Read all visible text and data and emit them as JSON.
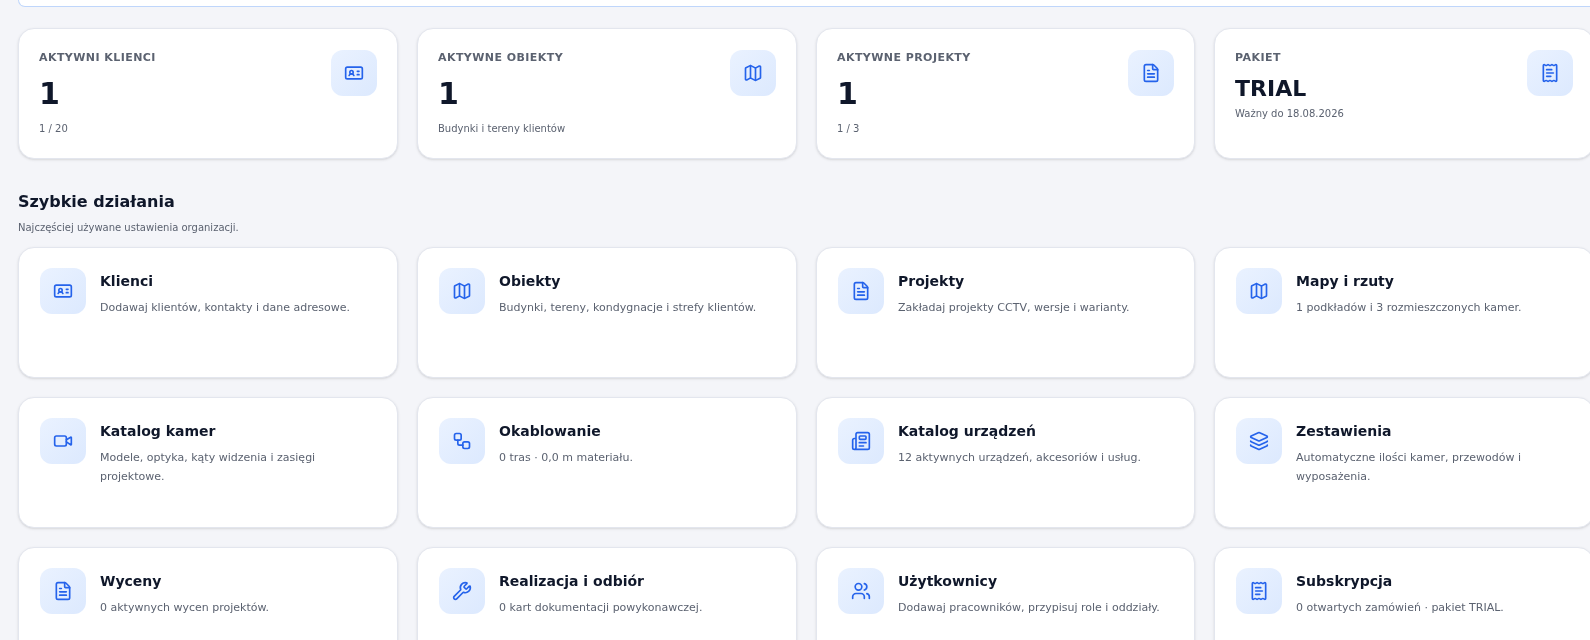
{
  "stats": [
    {
      "kind": "count",
      "label": "AKTYWNI KLIENCI",
      "value": "1",
      "note": "1 / 20"
    },
    {
      "kind": "count",
      "label": "AKTYWNE OBIEKTY",
      "value": "1",
      "note": "Budynki i tereny klientów"
    },
    {
      "kind": "count",
      "label": "AKTYWNE PROJEKTY",
      "value": "1",
      "note": "1 / 3"
    },
    {
      "kind": "plan",
      "label": "PAKIET",
      "value": "TRIAL",
      "note": "Ważny do 18.08.2026"
    }
  ],
  "quick_actions": {
    "title": "Szybkie działania",
    "subtitle": "Najczęściej używane ustawienia organizacji.",
    "items": [
      {
        "title": "Klienci",
        "description": "Dodawaj klientów, kontakty i dane adresowe."
      },
      {
        "title": "Obiekty",
        "description": "Budynki, tereny, kondygnacje i strefy klientów."
      },
      {
        "title": "Projekty",
        "description": "Zakładaj projekty CCTV, wersje i warianty."
      },
      {
        "title": "Mapy i rzuty",
        "description": "1 podkładów i 3 rozmieszczonych kamer."
      },
      {
        "title": "Katalog kamer",
        "description": "Modele, optyka, kąty widzenia i zasięgi projektowe."
      },
      {
        "title": "Okablowanie",
        "description": "0 tras · 0,0 m materiału."
      },
      {
        "title": "Katalog urządzeń",
        "description": "12 aktywnych urządzeń, akcesoriów i usług."
      },
      {
        "title": "Zestawienia",
        "description": "Automatyczne ilości kamer, przewodów i wyposażenia."
      },
      {
        "title": "Wyceny",
        "description": "0 aktywnych wycen projektów."
      },
      {
        "title": "Realizacja i odbiór",
        "description": "0 kart dokumentacji powykonawczej."
      },
      {
        "title": "Użytkownicy",
        "description": "Dodawaj pracowników, przypisuj role i oddziały."
      },
      {
        "title": "Subskrypcja",
        "description": "0 otwartych zamówień · pakiet TRIAL."
      }
    ]
  }
}
